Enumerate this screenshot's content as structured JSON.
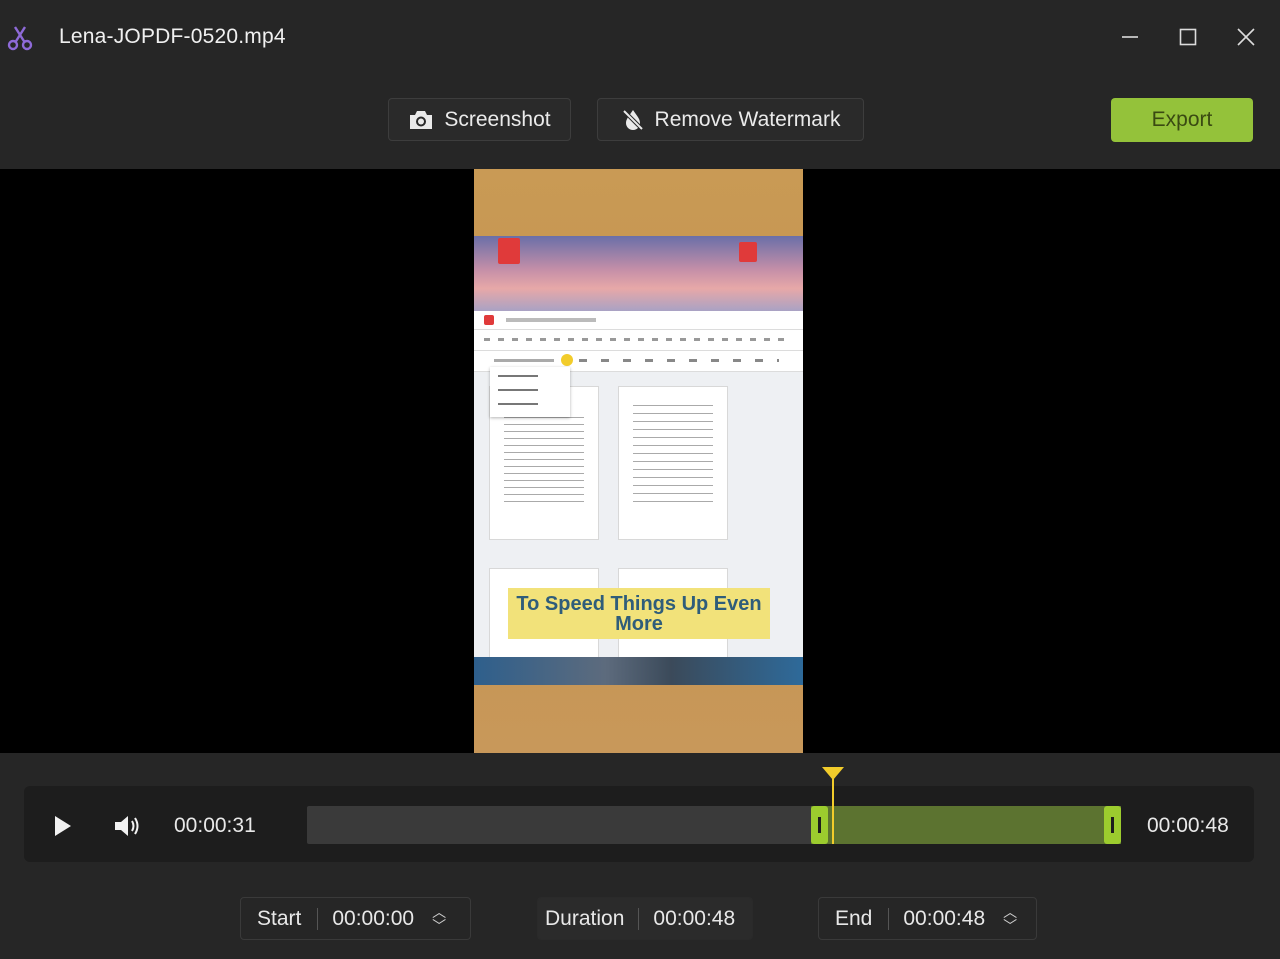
{
  "window": {
    "title": "Lena-JOPDF-0520.mp4",
    "icons": [
      "scissors-icon",
      "minimize-icon",
      "maximize-icon",
      "close-icon"
    ]
  },
  "toolbar": {
    "screenshot_label": "Screenshot",
    "remove_watermark_label": "Remove Watermark",
    "export_label": "Export",
    "accent_color": "#94c23a"
  },
  "video": {
    "caption": "To Speed Things Up Even More"
  },
  "player": {
    "current_time": "00:00:31",
    "end_time_display": "00:00:48",
    "playhead_fraction": 0.646,
    "selection_start_fraction": 0.625,
    "selection_end_fraction": 1.0
  },
  "trim": {
    "start_label": "Start",
    "start_value": "00:00:00",
    "duration_label": "Duration",
    "duration_value": "00:00:48",
    "end_label": "End",
    "end_value": "00:00:48"
  }
}
